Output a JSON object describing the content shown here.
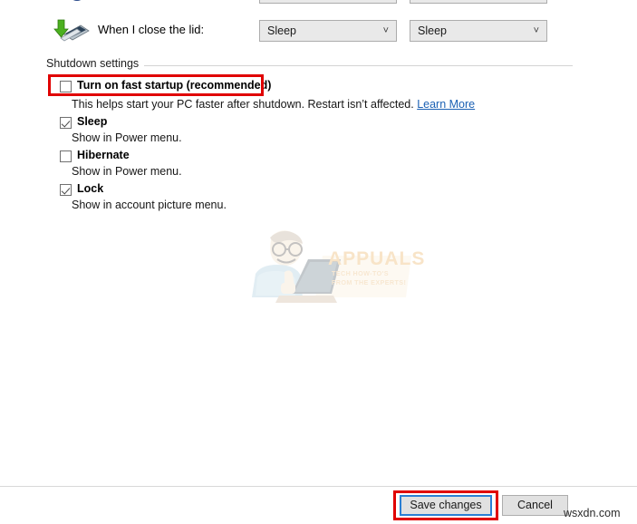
{
  "power_options": {
    "lid_row": {
      "icon": "laptop-lid-icon",
      "label": "When I close the lid:",
      "on_battery_value": "Sleep",
      "plugged_in_value": "Sleep"
    },
    "shutdown_settings": {
      "group_title": "Shutdown settings",
      "items": [
        {
          "id": "fast-startup",
          "label": "Turn on fast startup (recommended)",
          "checked": false,
          "description": "This helps start your PC faster after shutdown. Restart isn’t affected.",
          "link_label": "Learn More",
          "highlighted": true
        },
        {
          "id": "sleep",
          "label": "Sleep",
          "checked": true,
          "description": "Show in Power menu."
        },
        {
          "id": "hibernate",
          "label": "Hibernate",
          "checked": false,
          "description": "Show in Power menu."
        },
        {
          "id": "lock",
          "label": "Lock",
          "checked": true,
          "description": "Show in account picture menu."
        }
      ]
    }
  },
  "footer": {
    "save_label": "Save changes",
    "cancel_label": "Cancel"
  },
  "annotations": {
    "highlight_color": "#e00000",
    "focus_color": "#2a7fd4",
    "link_color": "#1b61b4"
  },
  "watermarks": {
    "brand": "APPUALS",
    "tagline": "TECH HOW-TO'S FROM THE EXPERTS!",
    "site": "wsxdn.com"
  }
}
